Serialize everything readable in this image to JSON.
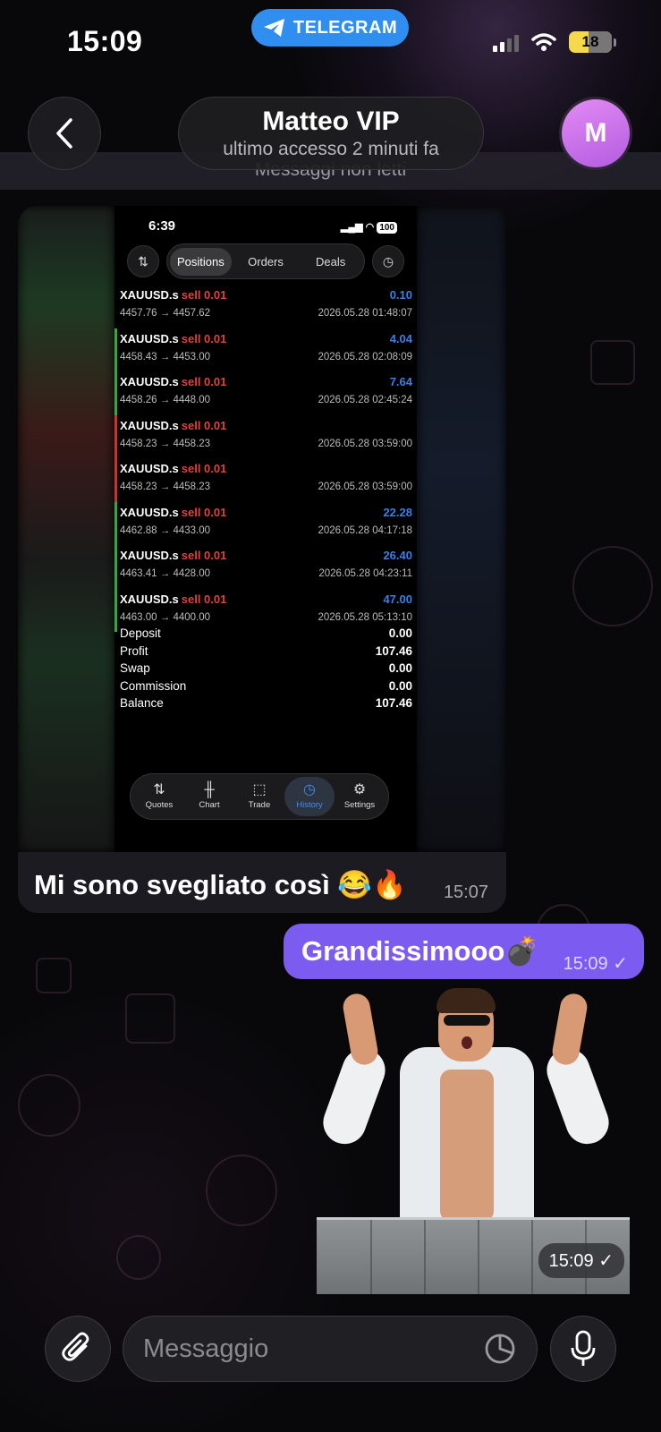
{
  "status_bar": {
    "time": "15:09",
    "app_pill": "TELEGRAM",
    "battery": "18"
  },
  "header": {
    "title": "Matteo VIP",
    "subtitle": "ultimo accesso 2 minuti fa",
    "avatar_initial": "M",
    "unread_label": "Messaggi non letti"
  },
  "incoming": {
    "caption": "Mi sono svegliato così 😂🔥",
    "time": "15:07",
    "screenshot": {
      "time": "6:39",
      "battery": "100",
      "tabs": [
        "Positions",
        "Orders",
        "Deals"
      ],
      "active_tab": "Positions",
      "trades": [
        {
          "symbol": "XAUUSD.s",
          "side": "sell 0.01",
          "prices": "4457.76 → 4457.62",
          "profit": "0.10",
          "datetime": "2026.05.28 01:48:07",
          "bar": "none"
        },
        {
          "symbol": "XAUUSD.s",
          "side": "sell 0.01",
          "prices": "4458.43 → 4453.00",
          "profit": "4.04",
          "datetime": "2026.05.28 02:08:09",
          "bar": "green"
        },
        {
          "symbol": "XAUUSD.s",
          "side": "sell 0.01",
          "prices": "4458.26 → 4448.00",
          "profit": "7.64",
          "datetime": "2026.05.28 02:45:24",
          "bar": "green"
        },
        {
          "symbol": "XAUUSD.s",
          "side": "sell 0.01",
          "prices": "4458.23 → 4458.23",
          "profit": "",
          "datetime": "2026.05.28 03:59:00",
          "bar": "red"
        },
        {
          "symbol": "XAUUSD.s",
          "side": "sell 0.01",
          "prices": "4458.23 → 4458.23",
          "profit": "",
          "datetime": "2026.05.28 03:59:00",
          "bar": "red"
        },
        {
          "symbol": "XAUUSD.s",
          "side": "sell 0.01",
          "prices": "4462.88 → 4433.00",
          "profit": "22.28",
          "datetime": "2026.05.28 04:17:18",
          "bar": "green"
        },
        {
          "symbol": "XAUUSD.s",
          "side": "sell 0.01",
          "prices": "4463.41 → 4428.00",
          "profit": "26.40",
          "datetime": "2026.05.28 04:23:11",
          "bar": "green"
        },
        {
          "symbol": "XAUUSD.s",
          "side": "sell 0.01",
          "prices": "4463.00 → 4400.00",
          "profit": "47.00",
          "datetime": "2026.05.28 05:13:10",
          "bar": "green"
        }
      ],
      "summary": [
        {
          "label": "Deposit",
          "value": "0.00"
        },
        {
          "label": "Profit",
          "value": "107.46"
        },
        {
          "label": "Swap",
          "value": "0.00"
        },
        {
          "label": "Commission",
          "value": "0.00"
        },
        {
          "label": "Balance",
          "value": "107.46"
        }
      ],
      "nav": [
        {
          "label": "Quotes",
          "icon": "quotes-icon",
          "glyph": "⇅"
        },
        {
          "label": "Chart",
          "icon": "candlestick-icon",
          "glyph": "╫"
        },
        {
          "label": "Trade",
          "icon": "trade-chart-icon",
          "glyph": "⬚"
        },
        {
          "label": "History",
          "icon": "history-icon",
          "glyph": "◷"
        },
        {
          "label": "Settings",
          "icon": "gear-icon",
          "glyph": "⚙"
        }
      ],
      "active_nav": "History"
    }
  },
  "outgoing": {
    "text": "Grandissimooo💣",
    "time": "15:09"
  },
  "sticker": {
    "time": "15:09"
  },
  "composer": {
    "placeholder": "Messaggio"
  },
  "colors": {
    "accent": "#7c5cf0",
    "telegram_blue": "#2f8ef0",
    "profit_blue": "#3d7fe8",
    "sell_red": "#e0423c",
    "bar_green": "#2faa3c",
    "bar_red": "#d3302c"
  }
}
